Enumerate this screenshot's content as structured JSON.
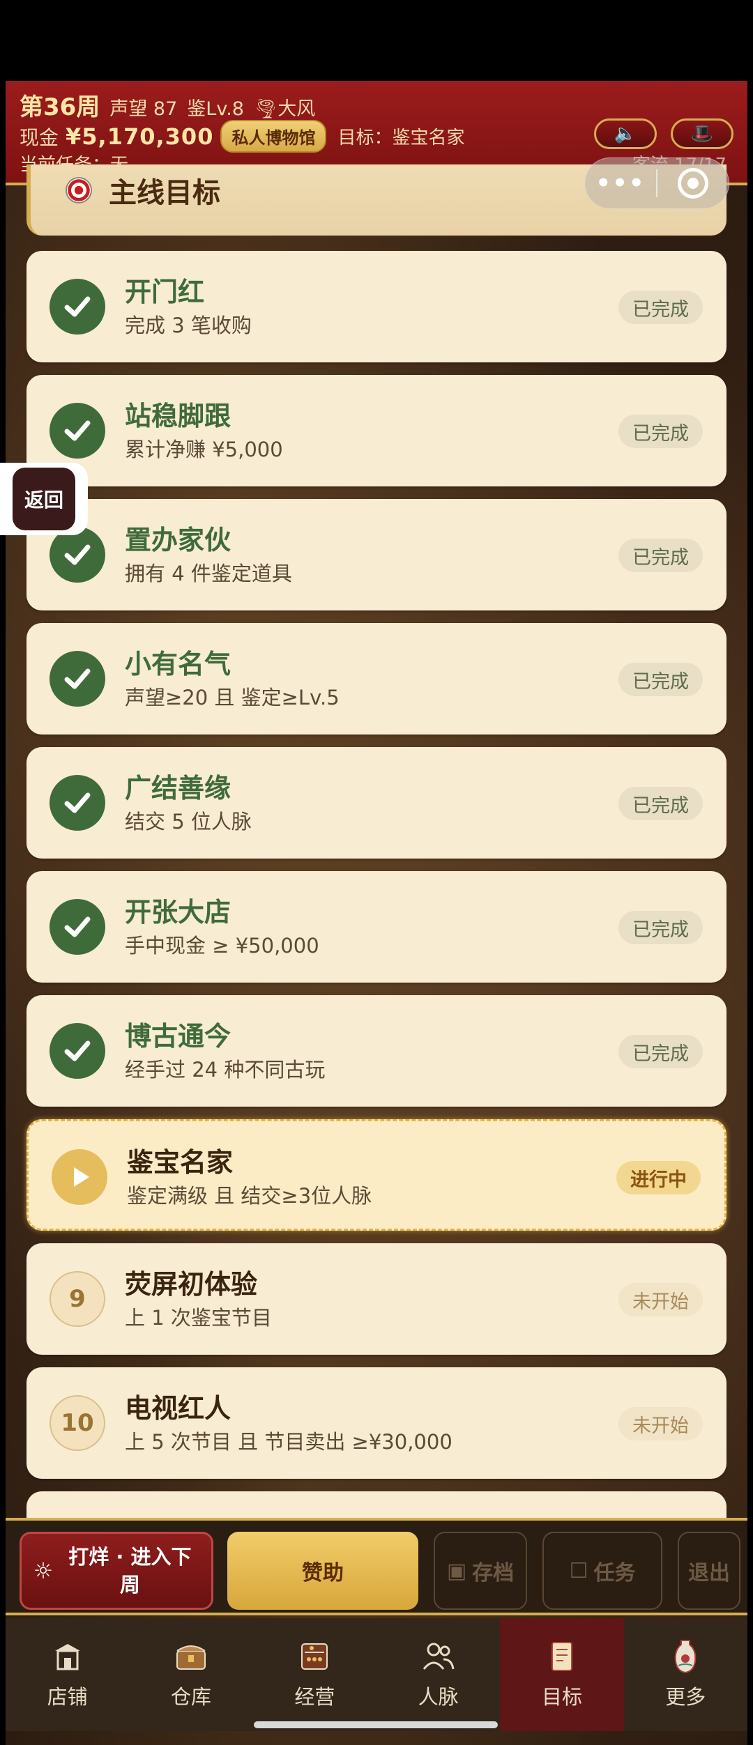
{
  "header": {
    "week": "第36周",
    "reputation": "声望 87",
    "appraisal": "鉴Lv.8",
    "weather": "大风",
    "cash_label": "现金",
    "cash": "¥5,170,300",
    "museum_badge": "私人博物馆",
    "goal": "目标：鉴宝名家",
    "current_task": "当前任务：无",
    "customer_flow": "客流 17/17"
  },
  "capsule": {
    "more": "•••"
  },
  "back_button": {
    "label": "返回"
  },
  "section": {
    "title": "主线目标"
  },
  "quests": [
    {
      "title": "开门红",
      "desc": "完成 3 笔收购",
      "status": "已完成"
    },
    {
      "title": "站稳脚跟",
      "desc": "累计净赚 ¥5,000",
      "status": "已完成"
    },
    {
      "title": "置办家伙",
      "desc": "拥有 4 件鉴定道具",
      "status": "已完成"
    },
    {
      "title": "小有名气",
      "desc": "声望≥20 且 鉴定≥Lv.5",
      "status": "已完成"
    },
    {
      "title": "广结善缘",
      "desc": "结交 5 位人脉",
      "status": "已完成"
    },
    {
      "title": "开张大店",
      "desc": "手中现金 ≥ ¥50,000",
      "status": "已完成"
    },
    {
      "title": "博古通今",
      "desc": "经手过 24 种不同古玩",
      "status": "已完成"
    },
    {
      "title": "鉴宝名家",
      "desc": "鉴定满级 且 结交≥3位人脉",
      "status": "进行中"
    },
    {
      "title": "荧屏初体验",
      "desc": "上 1 次鉴宝节目",
      "status": "未开始",
      "number": "9"
    },
    {
      "title": "电视红人",
      "desc": "上 5 次节目 且 节目卖出 ≥¥30,000",
      "status": "未开始",
      "number": "10"
    }
  ],
  "actions": {
    "next_week": "打烊 · 进入下周",
    "sponsor": "赞助",
    "save": "存档",
    "task": "任务",
    "quit": "退出"
  },
  "nav": {
    "shop": "店铺",
    "warehouse": "仓库",
    "business": "经营",
    "contacts": "人脉",
    "goals": "目标",
    "more": "更多"
  },
  "colors": {
    "header_red": "#9c1c1c",
    "gold": "#d6ae52",
    "done_green": "#3f6b3a",
    "card_bg": "#f8ecd3",
    "nav_active": "#5e1616"
  }
}
